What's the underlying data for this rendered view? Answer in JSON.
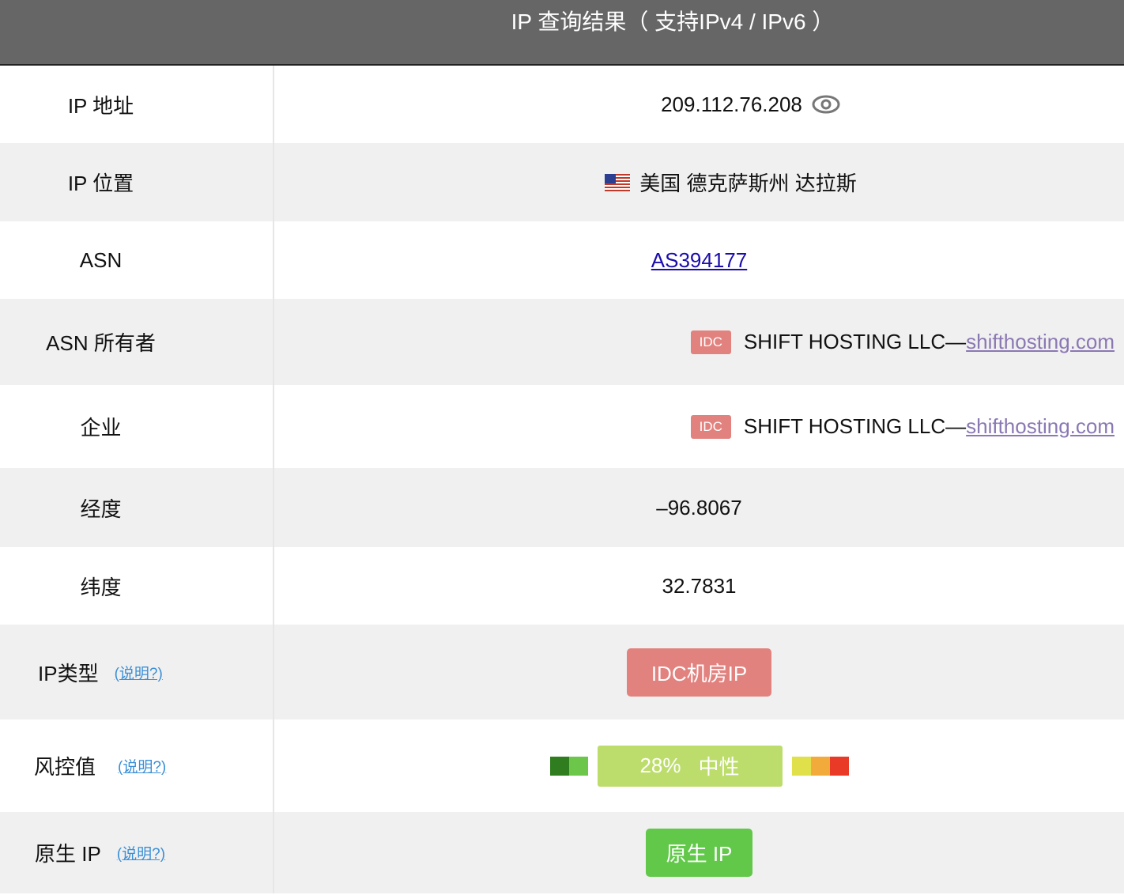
{
  "title": "IP 查询结果（ 支持IPv4 / IPv6 ）",
  "rows": {
    "ip": {
      "label": "IP 地址",
      "value": "209.112.76.208"
    },
    "location": {
      "label": "IP 位置",
      "flag": "🇺🇸",
      "value": "美国 德克萨斯州 达拉斯"
    },
    "asn": {
      "label": "ASN",
      "value": "AS394177"
    },
    "asn_owner": {
      "label": "ASN 所有者",
      "badge": "IDC",
      "name": "SHIFT HOSTING LLC—",
      "site": "shifthosting.com"
    },
    "company": {
      "label": "企业",
      "badge": "IDC",
      "name": "SHIFT HOSTING LLC—",
      "site": "shifthosting.com"
    },
    "longitude": {
      "label": "经度",
      "value": "–96.8067"
    },
    "latitude": {
      "label": "纬度",
      "value": "32.7831"
    },
    "ip_type": {
      "label": "IP类型",
      "help": "(说明?)",
      "value": "IDC机房IP"
    },
    "risk": {
      "label": "风控值",
      "help": "(说明?)",
      "percent": "28%",
      "level": "中性",
      "colors": [
        "#2f7d1e",
        "#6bc64a",
        "#bcdd6c",
        "#dfe04a",
        "#f2ab3b",
        "#e83a27"
      ]
    },
    "native": {
      "label": "原生 IP",
      "help": "(说明?)",
      "value": "原生 IP"
    }
  }
}
